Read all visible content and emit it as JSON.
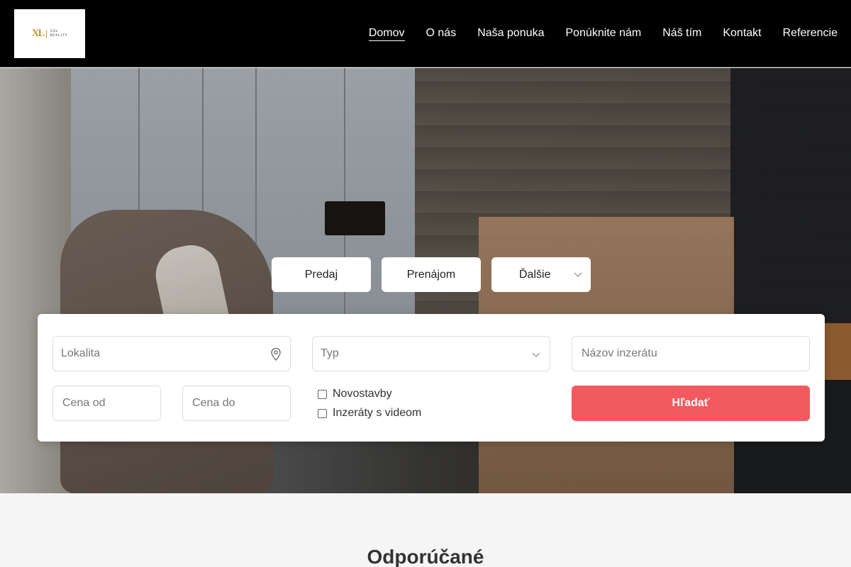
{
  "header": {
    "logo": {
      "mark": "XL",
      "line1": "XXL",
      "line2": "REALITY"
    },
    "nav": [
      {
        "label": "Domov",
        "active": true
      },
      {
        "label": "O nás"
      },
      {
        "label": "Naša ponuka"
      },
      {
        "label": "Ponúknite nám"
      },
      {
        "label": "Náš tím"
      },
      {
        "label": "Kontakt"
      },
      {
        "label": "Referencie"
      }
    ]
  },
  "search": {
    "tabs": [
      {
        "label": "Predaj"
      },
      {
        "label": "Prenájom"
      },
      {
        "label": "Ďalšie",
        "icon": "chevron-down-icon"
      }
    ],
    "location": {
      "placeholder": "Lokalita",
      "icon": "map-pin-icon"
    },
    "type": {
      "label": "Typ",
      "icon": "chevron-down-icon"
    },
    "title": {
      "placeholder": "Názov inzerátu"
    },
    "price_from": {
      "placeholder": "Cena od"
    },
    "price_to": {
      "placeholder": "Cena do"
    },
    "checkboxes": [
      {
        "label": "Novostavby",
        "checked": false
      },
      {
        "label": "Inzeráty s videom",
        "checked": false
      }
    ],
    "submit_label": "Hľadať"
  },
  "section": {
    "title": "Odporúčané"
  },
  "colors": {
    "header_bg": "#000000",
    "accent": "#f25a5f",
    "logo_gold": "#c59d3a",
    "page_bg": "#f5f5f5"
  }
}
